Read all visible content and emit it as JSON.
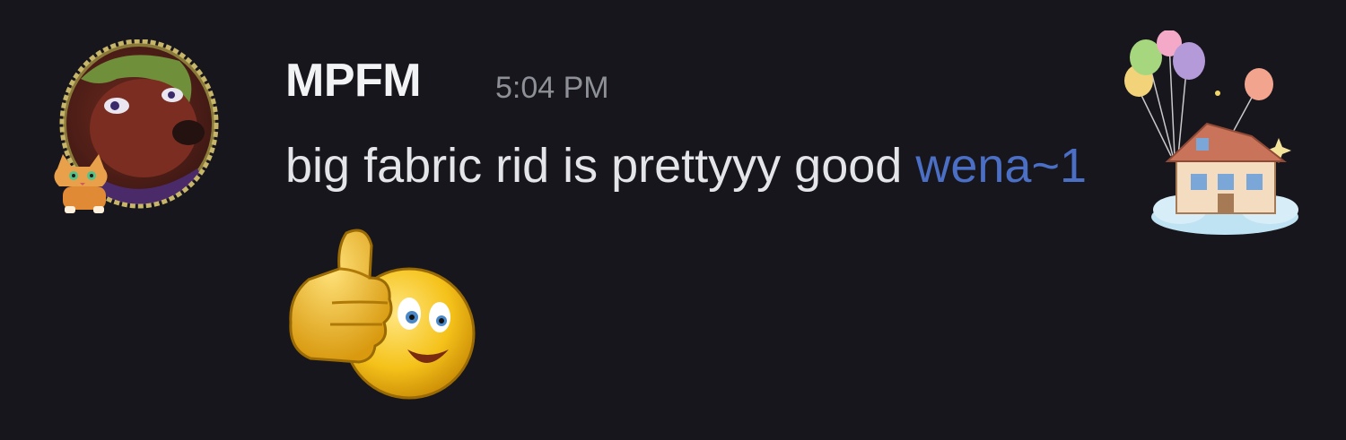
{
  "message": {
    "author": "MPFM",
    "timestamp": "5:04 PM",
    "content": "big fabric rid is prettyyy good",
    "tag": "wena~1"
  },
  "icons": {
    "avatar": "avatar-icon",
    "cat_decoration": "cat-icon",
    "sticker": "thumbs-up-emoji-icon",
    "balloons": "balloons-icon",
    "house": "floating-house-icon"
  },
  "colors": {
    "background": "#17161d",
    "username": "#f2f3f5",
    "timestamp": "#8e9097",
    "text": "#e4e5e8",
    "tag": "#4b6fc4"
  }
}
